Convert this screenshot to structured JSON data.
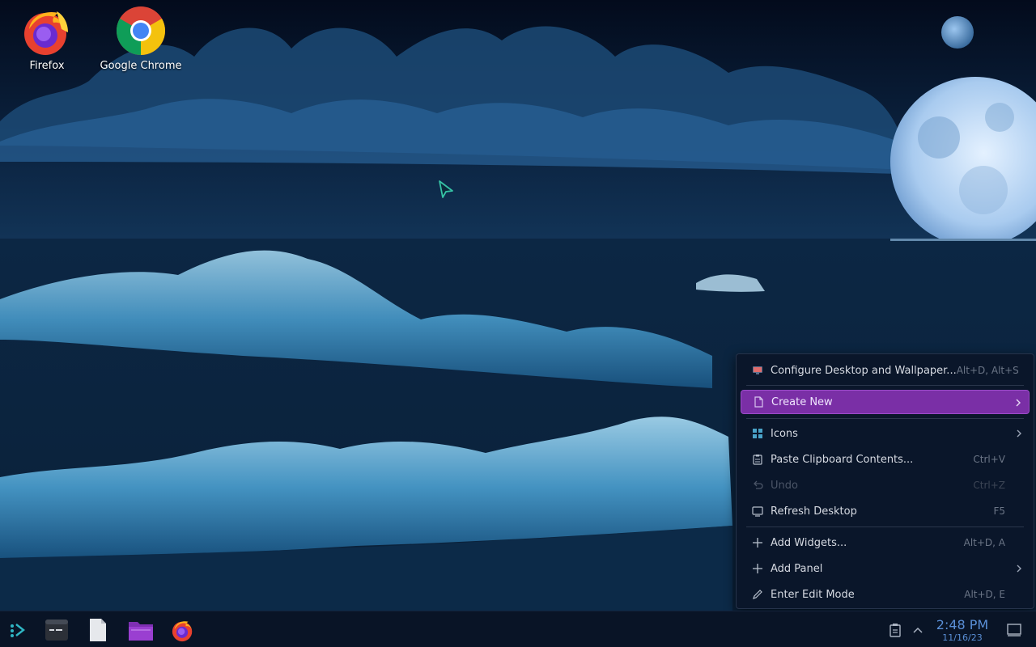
{
  "desktop": {
    "icons": [
      {
        "label": "Firefox",
        "icon": "firefox-icon"
      },
      {
        "label": "Google Chrome",
        "icon": "chrome-icon"
      }
    ]
  },
  "context_menu": {
    "items": [
      {
        "label": "Configure Desktop and Wallpaper...",
        "shortcut": "Alt+D, Alt+S",
        "icon": "configure-desktop-icon"
      },
      {
        "label": "Create New",
        "shortcut": "",
        "icon": "new-file-icon",
        "submenu": true,
        "highlighted": true
      },
      {
        "label": "Icons",
        "shortcut": "",
        "icon": "icons-grid-icon",
        "submenu": true
      },
      {
        "label": "Paste Clipboard Contents...",
        "shortcut": "Ctrl+V",
        "icon": "clipboard-icon"
      },
      {
        "label": "Undo",
        "shortcut": "Ctrl+Z",
        "icon": "undo-icon",
        "disabled": true
      },
      {
        "label": "Refresh Desktop",
        "shortcut": "F5",
        "icon": "refresh-icon"
      },
      {
        "label": "Add Widgets...",
        "shortcut": "Alt+D, A",
        "icon": "plus-icon"
      },
      {
        "label": "Add Panel",
        "shortcut": "",
        "icon": "plus-icon",
        "submenu": true
      },
      {
        "label": "Enter Edit Mode",
        "shortcut": "Alt+D, E",
        "icon": "pencil-icon"
      }
    ]
  },
  "taskbar": {
    "launchers": [
      "application-launcher-icon",
      "terminal-icon",
      "text-editor-icon",
      "file-manager-icon",
      "firefox-icon"
    ],
    "tray": [
      "clipboard-icon",
      "chevron-up-icon"
    ],
    "clock": {
      "time": "2:48 PM",
      "date": "11/16/23"
    },
    "show_desktop": "show-desktop-icon"
  },
  "colors": {
    "accent": "#7a2fa6",
    "menu_bg": "#0a162a",
    "taskbar_bg": "#091426",
    "clock": "#5a8fd6"
  }
}
